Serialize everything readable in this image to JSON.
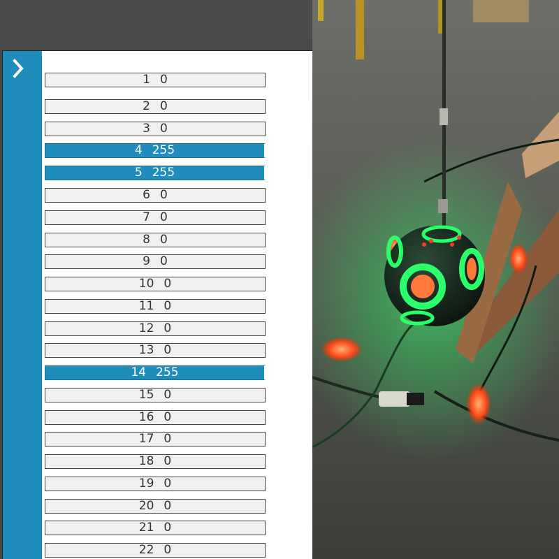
{
  "app": {
    "accent": "#1f8dbb"
  },
  "sidebar": {
    "expand_icon": "chevron-right-icon"
  },
  "channels": [
    {
      "n": "1",
      "v": "0"
    },
    {
      "n": "2",
      "v": "0"
    },
    {
      "n": "3",
      "v": "0"
    },
    {
      "n": "4",
      "v": "255"
    },
    {
      "n": "5",
      "v": "255"
    },
    {
      "n": "6",
      "v": "0"
    },
    {
      "n": "7",
      "v": "0"
    },
    {
      "n": "8",
      "v": "0"
    },
    {
      "n": "9",
      "v": "0"
    },
    {
      "n": "10",
      "v": "0"
    },
    {
      "n": "11",
      "v": "0"
    },
    {
      "n": "12",
      "v": "0"
    },
    {
      "n": "13",
      "v": "0"
    },
    {
      "n": "14",
      "v": "255"
    },
    {
      "n": "15",
      "v": "0"
    },
    {
      "n": "16",
      "v": "0"
    },
    {
      "n": "17",
      "v": "0"
    },
    {
      "n": "18",
      "v": "0"
    },
    {
      "n": "19",
      "v": "0"
    },
    {
      "n": "20",
      "v": "0"
    },
    {
      "n": "21",
      "v": "0"
    },
    {
      "n": "22",
      "v": "0"
    }
  ],
  "photo": {
    "subject": "green LED sphere light fixture hanging over concrete floor"
  }
}
